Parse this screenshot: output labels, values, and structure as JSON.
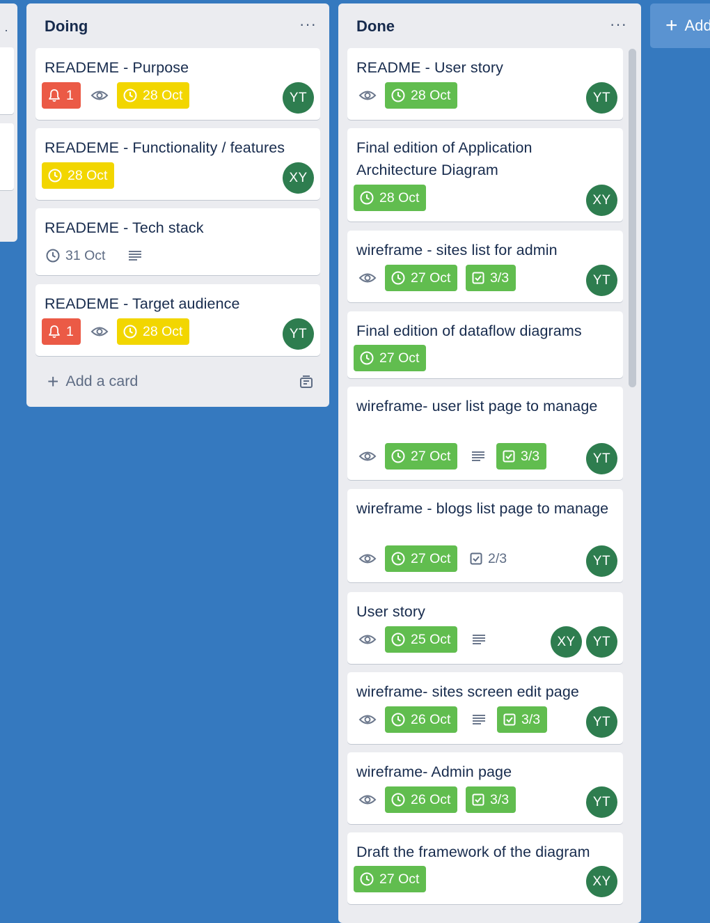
{
  "board": {
    "add_list_label": "Add another list",
    "add_list_visible": "Add"
  },
  "doing": {
    "title": "Doing",
    "add_card_label": "Add a card",
    "cards": [
      {
        "title": "READEME - Purpose",
        "notifications": "1",
        "due": "28 Oct",
        "avatar": "YT"
      },
      {
        "title": "READEME - Functionality / features",
        "due": "28 Oct",
        "avatar": "XY"
      },
      {
        "title": "READEME - Tech stack",
        "due": "31 Oct"
      },
      {
        "title": "READEME - Target audience",
        "notifications": "1",
        "due": "28 Oct",
        "avatar": "YT"
      }
    ]
  },
  "done": {
    "title": "Done",
    "cards": [
      {
        "title": "README - User story",
        "due": "28 Oct",
        "avatar": "YT"
      },
      {
        "title": "Final edition of Application Architecture Diagram",
        "due": "28 Oct",
        "avatar": "XY"
      },
      {
        "title": "wireframe - sites list for admin",
        "due": "27 Oct",
        "checklist": "3/3",
        "avatar": "YT"
      },
      {
        "title": "Final edition of dataflow diagrams",
        "due": "27 Oct"
      },
      {
        "title": "wireframe- user list page to manage",
        "due": "27 Oct",
        "checklist": "3/3",
        "avatar": "YT"
      },
      {
        "title": "wireframe - blogs list page to manage",
        "due": "27 Oct",
        "checklist": "2/3",
        "avatar": "YT"
      },
      {
        "title": "User story",
        "due": "25 Oct",
        "avatars": [
          "XY",
          "YT"
        ]
      },
      {
        "title": "wireframe- sites screen edit page",
        "due": "26 Oct",
        "checklist": "3/3",
        "avatar": "YT"
      },
      {
        "title": "wireframe- Admin page",
        "due": "26 Oct",
        "checklist": "3/3",
        "avatar": "YT"
      },
      {
        "title": "Draft the framework of the diagram",
        "due": "27 Oct",
        "avatar": "XY"
      }
    ]
  },
  "colors": {
    "board_bg": "#3579bf",
    "list_bg": "#ebecf0",
    "due_complete": "#61bd4f",
    "due_soon": "#f2d600",
    "notification": "#eb5a46",
    "avatar": "#2e7d4f"
  },
  "icons": {
    "clock": "clock-icon",
    "bell": "bell-icon",
    "eye": "eye-icon",
    "description": "description-icon",
    "checklist": "checklist-icon",
    "more": "more-icon",
    "plus": "plus-icon",
    "template": "card-template-icon"
  }
}
